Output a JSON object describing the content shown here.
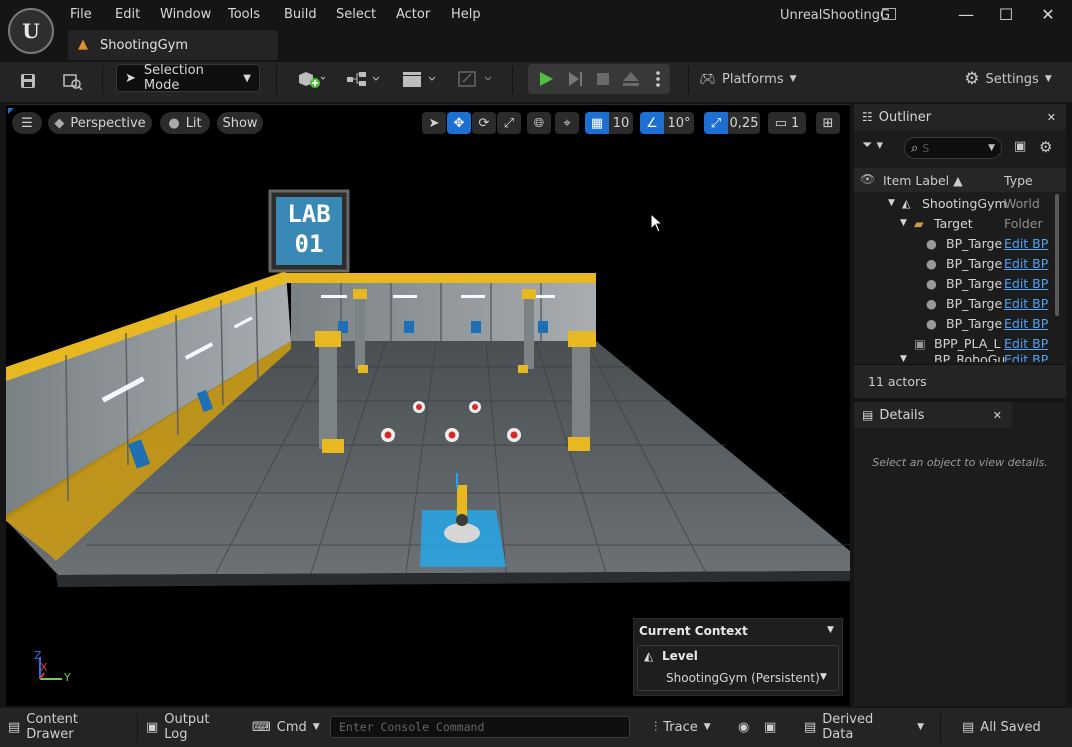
{
  "app": {
    "window_title": "UnrealShootingGym",
    "doc_tab": "ShootingGym",
    "logo_text": "U"
  },
  "menu": [
    "File",
    "Edit",
    "Window",
    "Tools",
    "Build",
    "Select",
    "Actor",
    "Help"
  ],
  "window_controls": {
    "minimize": "—",
    "maximize": "☐",
    "close": "✕"
  },
  "toolbar": {
    "selection_mode": "Selection Mode",
    "platforms": "Platforms",
    "settings": "Settings"
  },
  "viewport": {
    "perspective": "Perspective",
    "lit": "Lit",
    "show": "Show",
    "grid_snap": "10",
    "rotation_snap": "10°",
    "scale_snap": "0,25",
    "camera_speed": "1",
    "sign_line1": "LAB",
    "sign_line2": "01",
    "axis_x": "X",
    "axis_y": "Y",
    "axis_z": "Z"
  },
  "current_context": {
    "header": "Current Context",
    "label": "Level",
    "value": "ShootingGym (Persistent)"
  },
  "outliner": {
    "title": "Outliner",
    "search_placeholder": "S",
    "col_label": "Item Label ▲",
    "col_type": "Type",
    "rows": [
      {
        "label": "ShootingGym",
        "type": "World"
      },
      {
        "label": "Target",
        "type": "Folder"
      },
      {
        "label": "BP_Targe",
        "type": "Edit BP"
      },
      {
        "label": "BP_Targe",
        "type": "Edit BP"
      },
      {
        "label": "BP_Targe",
        "type": "Edit BP"
      },
      {
        "label": "BP_Targe",
        "type": "Edit BP"
      },
      {
        "label": "BP_Targe",
        "type": "Edit BP"
      },
      {
        "label": "BPP_PLA_L",
        "type": "Edit BP"
      },
      {
        "label": "BP_RoboGu",
        "type": "Edit BP"
      }
    ],
    "actor_count": "11 actors"
  },
  "details": {
    "title": "Details",
    "empty_message": "Select an object to view details."
  },
  "statusbar": {
    "content_drawer": "Content Drawer",
    "output_log": "Output Log",
    "cmd": "Cmd",
    "console_placeholder": "Enter Console Command",
    "trace": "Trace",
    "derived_data": "Derived Data",
    "all_saved": "All Saved"
  },
  "colors": {
    "accent_blue": "#1d6fd2",
    "play_green": "#4fbf3f",
    "link_blue": "#4fa3f7",
    "wall_trim_yellow": "#e8b820"
  }
}
